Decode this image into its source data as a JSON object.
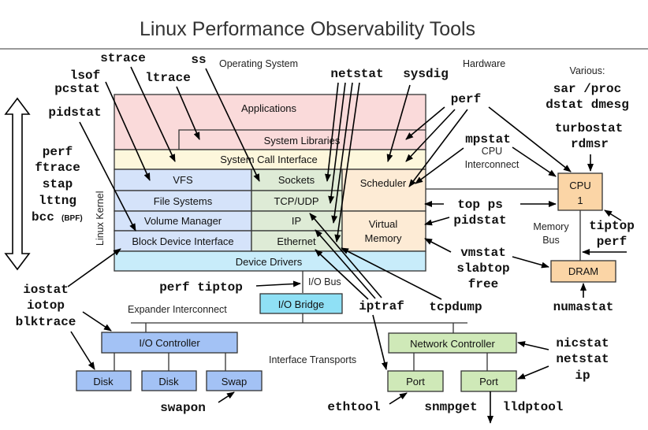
{
  "title": "Linux Performance Observability Tools",
  "region_labels": {
    "os": "Operating System",
    "hardware": "Hardware",
    "linux_kernel": "Linux Kernel",
    "cpu_interconnect_1": "CPU",
    "cpu_interconnect_2": "Interconnect",
    "memory_bus_1": "Memory",
    "memory_bus_2": "Bus",
    "io_bus": "I/O Bus",
    "expander": "Expander Interconnect",
    "transports": "Interface Transports",
    "various": "Various:"
  },
  "layers": {
    "applications": "Applications",
    "system_libraries": "System Libraries",
    "syscall": "System Call Interface",
    "vfs": "VFS",
    "file_systems": "File Systems",
    "volume_manager": "Volume Manager",
    "block_device": "Block Device Interface",
    "sockets": "Sockets",
    "tcp_udp": "TCP/UDP",
    "ip": "IP",
    "ethernet": "Ethernet",
    "scheduler": "Scheduler",
    "virtual_memory_1": "Virtual",
    "virtual_memory_2": "Memory",
    "device_drivers": "Device Drivers"
  },
  "hardware": {
    "cpu_1": "CPU",
    "cpu_2": "1",
    "dram": "DRAM",
    "io_bridge": "I/O Bridge",
    "io_controller": "I/O Controller",
    "disk1": "Disk",
    "disk2": "Disk",
    "swap": "Swap",
    "network_controller": "Network Controller",
    "port1": "Port",
    "port2": "Port"
  },
  "tools": {
    "strace": "strace",
    "ss": "ss",
    "lsof": "lsof",
    "ltrace": "ltrace",
    "pcstat": "pcstat",
    "pidstat_left": "pidstat",
    "netstat_top": "netstat",
    "sysdig": "sysdig",
    "perf_top": "perf",
    "various_1": "sar /proc",
    "various_2": "dstat dmesg",
    "turbostat": "turbostat",
    "rdmsr": "rdmsr",
    "mpstat": "mpstat",
    "top_ps": "top ps",
    "pidstat_right": "pidstat",
    "tiptop_right": "tiptop",
    "perf_right": "perf",
    "vmstat": "vmstat",
    "slabtop": "slabtop",
    "free": "free",
    "numastat": "numastat",
    "left_perf": "perf",
    "left_ftrace": "ftrace",
    "left_stap": "stap",
    "left_lttng": "lttng",
    "left_bcc": "bcc",
    "left_bpf": "(BPF)",
    "iostat": "iostat",
    "iotop": "iotop",
    "blktrace": "blktrace",
    "perf_tiptop": "perf tiptop",
    "iptraf": "iptraf",
    "tcpdump": "tcpdump",
    "swapon": "swapon",
    "ethtool": "ethtool",
    "snmpget": "snmpget",
    "lldptool": "lldptool",
    "nicstat": "nicstat",
    "netstat_bottom": "netstat",
    "ip": "ip"
  },
  "colors": {
    "applications": "#fadada",
    "syscall": "#fdf7dc",
    "storage": "#d5e3fa",
    "network": "#deebd6",
    "scheduler": "#fdebd5",
    "drivers": "#c8ecfa",
    "cpu": "#fbd5a6",
    "io_bridge": "#8fe0f5",
    "io_blue": "#a3c2f5",
    "net_green": "#cfe9b8"
  }
}
